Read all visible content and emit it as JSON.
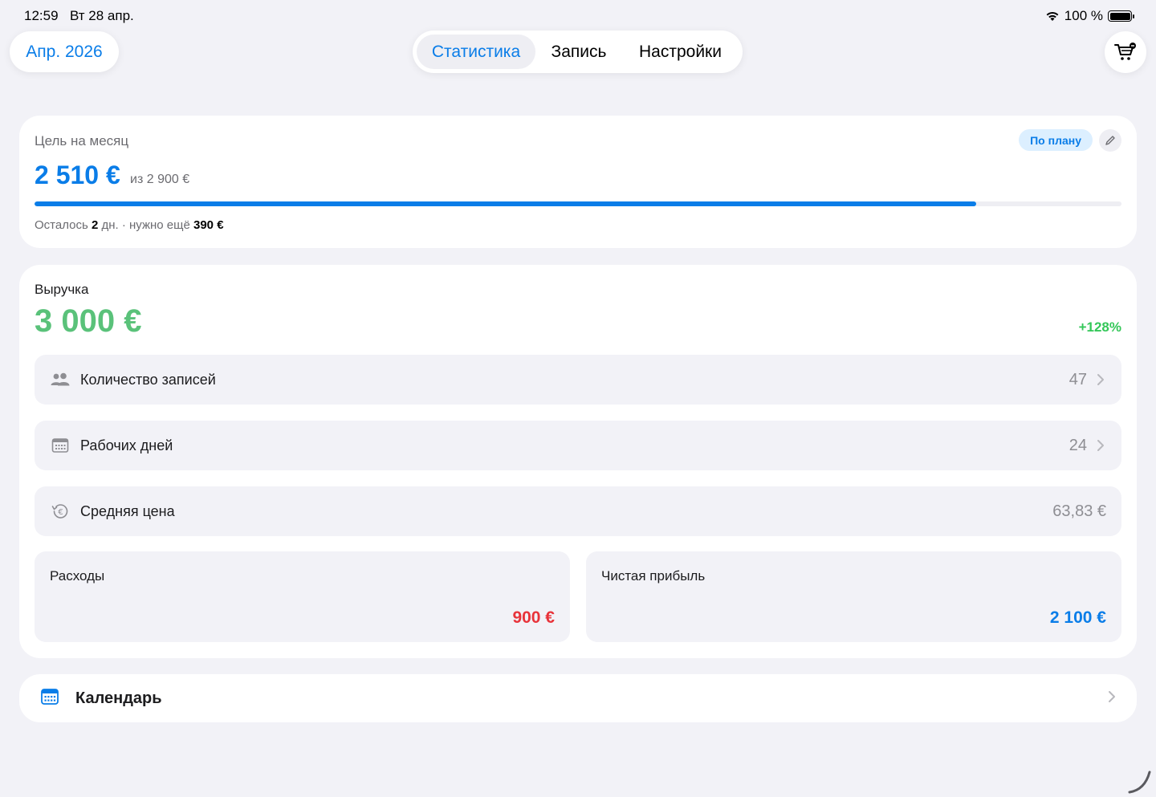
{
  "status_bar": {
    "time": "12:59",
    "date": "Вт 28 апр.",
    "battery": "100 %",
    "wifi_icon": "wifi-icon",
    "battery_icon": "battery-icon"
  },
  "header": {
    "month_label": "Апр. 2026",
    "tabs": [
      {
        "label": "Статистика",
        "active": true
      },
      {
        "label": "Запись",
        "active": false
      },
      {
        "label": "Настройки",
        "active": false
      }
    ],
    "cart_icon": "cart-icon"
  },
  "goal": {
    "title": "Цель на месяц",
    "badge": "По плану",
    "value": "2 510 €",
    "of_text": "из 2 900 €",
    "progress_fraction": 0.866,
    "footer_prefix": "Осталось ",
    "footer_days": "2",
    "footer_mid": " дн. · нужно ещё ",
    "footer_amount": "390 €"
  },
  "revenue": {
    "title": "Выручка",
    "value": "3 000 €",
    "delta": "+128%",
    "rows": [
      {
        "label": "Количество записей",
        "value": "47",
        "icon": "people-icon"
      },
      {
        "label": "Рабочих дней",
        "value": "24",
        "icon": "calendar-icon"
      },
      {
        "label": "Средняя цена",
        "value": "63,83 €",
        "icon": "euro-history-icon"
      }
    ],
    "expenses_label": "Расходы",
    "expenses_value": "900 €",
    "profit_label": "Чистая прибыль",
    "profit_value": "2 100 €"
  },
  "calendar": {
    "label": "Календарь"
  },
  "colors": {
    "accent": "#0a7de8",
    "revenue": "#5ac27a",
    "positive": "#34c759",
    "negative": "#e8333a"
  }
}
